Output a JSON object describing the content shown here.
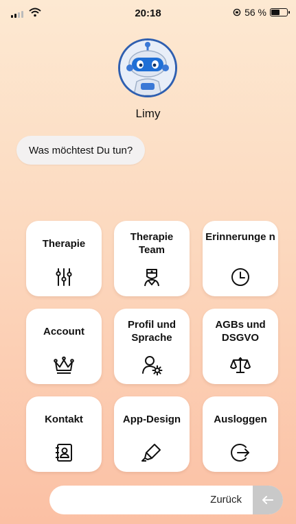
{
  "status": {
    "time": "20:18",
    "battery": "56 %",
    "battery_level": 0.56
  },
  "bot": {
    "name": "Limy"
  },
  "prompt": "Was möchtest Du tun?",
  "menu": [
    {
      "label": "Therapie",
      "icon": "sliders-icon"
    },
    {
      "label": "Therapie Team",
      "icon": "doctor-icon"
    },
    {
      "label": "Erinnerunge n",
      "icon": "clock-icon"
    },
    {
      "label": "Account",
      "icon": "crown-icon"
    },
    {
      "label": "Profil und Sprache",
      "icon": "user-settings-icon"
    },
    {
      "label": "AGBs und DSGVO",
      "icon": "scales-icon"
    },
    {
      "label": "Kontakt",
      "icon": "contact-book-icon"
    },
    {
      "label": "App-Design",
      "icon": "highlighter-icon"
    },
    {
      "label": "Ausloggen",
      "icon": "logout-icon"
    }
  ],
  "back": {
    "label": "Zurück",
    "icon": "arrow-left-icon"
  },
  "colors": {
    "accent": "#2f5fb0",
    "background_top": "#fde9d2",
    "background_bottom": "#fbc0a4"
  }
}
